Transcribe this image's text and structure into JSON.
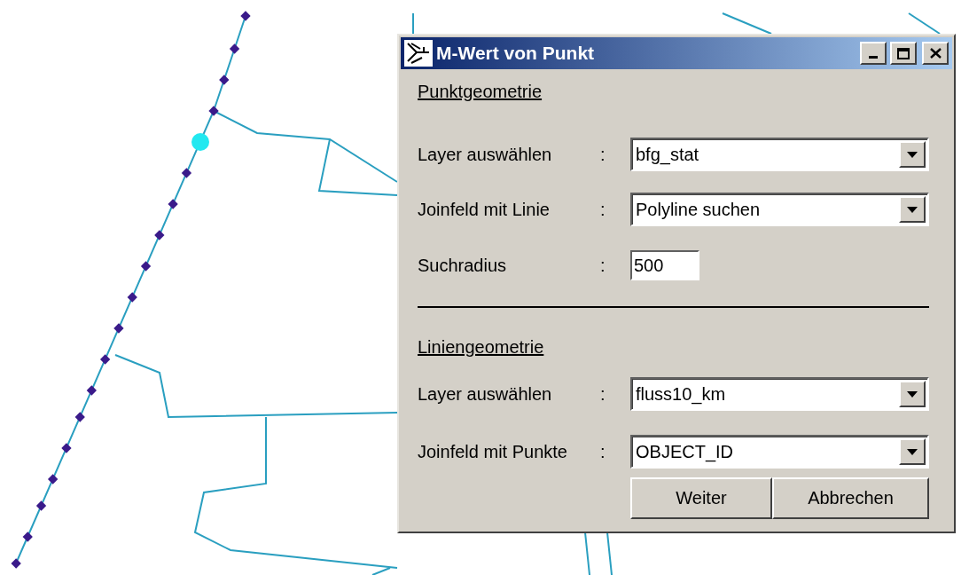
{
  "window": {
    "title": "M-Wert von Punkt"
  },
  "sections": [
    {
      "heading": "Punktgeometrie",
      "fields": [
        {
          "kind": "combo",
          "label": "Layer auswählen",
          "separator": ":",
          "value": "bfg_stat"
        },
        {
          "kind": "combo",
          "label": "Joinfeld mit Linie",
          "separator": ":",
          "value": "Polyline suchen"
        },
        {
          "kind": "text",
          "label": "Suchradius",
          "separator": ":",
          "value": "500"
        }
      ]
    },
    {
      "heading": "Liniengeometrie",
      "fields": [
        {
          "kind": "combo",
          "label": "Layer auswählen",
          "separator": ":",
          "value": "fluss10_km"
        },
        {
          "kind": "combo",
          "label": "Joinfeld mit Punkte",
          "separator": ":",
          "value": "OBJECT_ID"
        }
      ]
    }
  ],
  "buttons": [
    "Weiter",
    "Abbrechen"
  ]
}
